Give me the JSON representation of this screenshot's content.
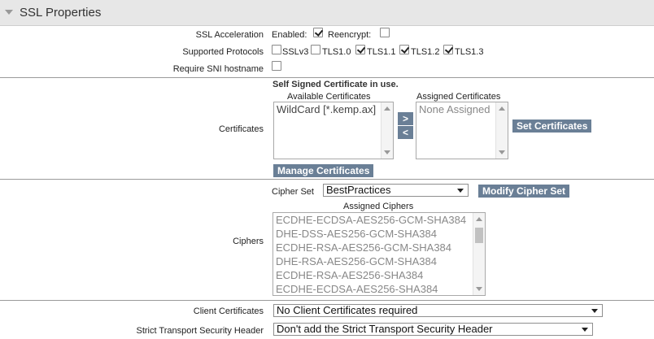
{
  "section": {
    "title": "SSL Properties"
  },
  "ssl_acceleration": {
    "label": "SSL Acceleration",
    "enabled_label": "Enabled:",
    "enabled_checked": true,
    "reencrypt_label": "Reencrypt:",
    "reencrypt_checked": false
  },
  "protocols": {
    "label": "Supported Protocols",
    "items": [
      {
        "name": "SSLv3",
        "checked": false
      },
      {
        "name": "TLS1.0",
        "checked": false
      },
      {
        "name": "TLS1.1",
        "checked": true
      },
      {
        "name": "TLS1.2",
        "checked": true
      },
      {
        "name": "TLS1.3",
        "checked": true
      }
    ]
  },
  "sni": {
    "label": "Require SNI hostname",
    "checked": false
  },
  "certificates": {
    "label": "Certificates",
    "notice": "Self Signed Certificate in use.",
    "available_header": "Available Certificates",
    "available_items": [
      "WildCard [*.kemp.ax]"
    ],
    "move_right_label": ">",
    "move_left_label": "<",
    "assigned_header": "Assigned Certificates",
    "assigned_items": [
      "None Assigned"
    ],
    "set_button": "Set Certificates",
    "manage_button": "Manage Certificates"
  },
  "ciphers": {
    "label": "Ciphers",
    "cipher_set_label": "Cipher Set",
    "cipher_set_value": "BestPractices",
    "modify_button": "Modify Cipher Set",
    "assigned_header": "Assigned Ciphers",
    "items": [
      "ECDHE-ECDSA-AES256-GCM-SHA384",
      "DHE-DSS-AES256-GCM-SHA384",
      "ECDHE-RSA-AES256-GCM-SHA384",
      "DHE-RSA-AES256-GCM-SHA384",
      "ECDHE-RSA-AES256-SHA384",
      "ECDHE-ECDSA-AES256-SHA384"
    ]
  },
  "client_certificates": {
    "label": "Client Certificates",
    "value": "No Client Certificates required"
  },
  "hsts": {
    "label": "Strict Transport Security Header",
    "value": "Don't add the Strict Transport Security Header"
  }
}
